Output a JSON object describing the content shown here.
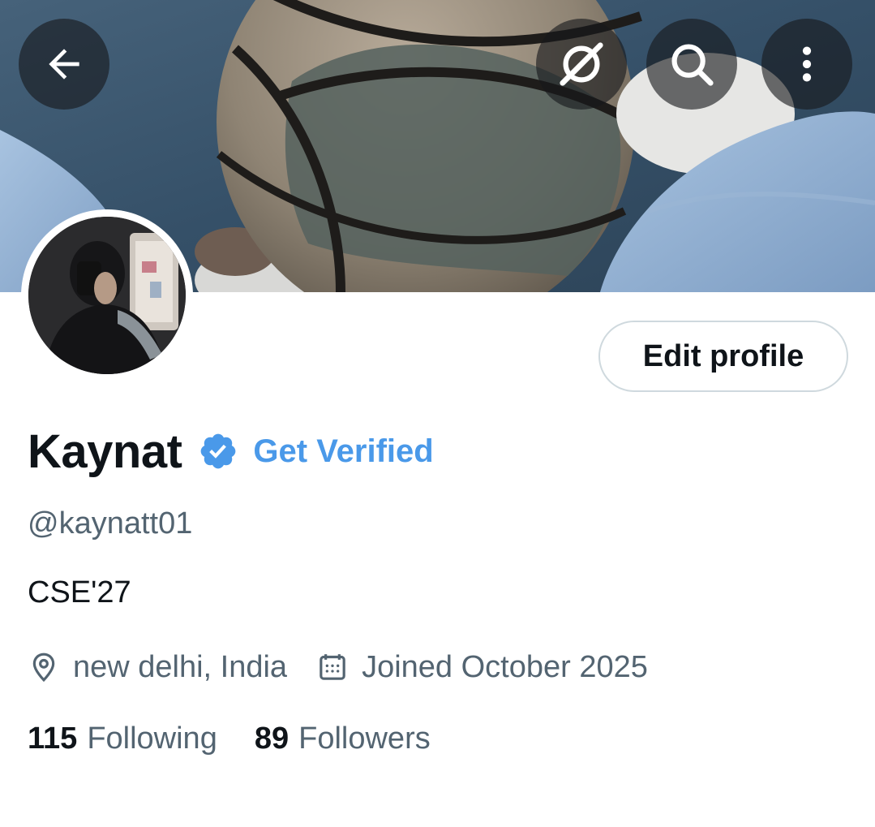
{
  "header": {
    "back_icon": "arrow-left-icon",
    "grok_icon": "grok-icon",
    "search_icon": "search-icon",
    "more_icon": "more-vertical-icon",
    "button_background": "#16181c"
  },
  "profile": {
    "display_name": "Kaynat",
    "verified_icon": "verified-badge-icon",
    "verified_color": "#4a99e9",
    "get_verified_label": "Get Verified",
    "handle": "@kaynatt01",
    "bio": "CSE'27",
    "location": "new delhi, India",
    "joined": "Joined October 2025",
    "location_icon": "location-pin-icon",
    "calendar_icon": "calendar-icon"
  },
  "actions": {
    "edit_profile_label": "Edit profile"
  },
  "stats": {
    "following_count": "115",
    "following_label": "Following",
    "followers_count": "89",
    "followers_label": "Followers"
  },
  "colors": {
    "primary_text": "#0f1419",
    "secondary_text": "#536471",
    "border": "#cfd9de"
  }
}
